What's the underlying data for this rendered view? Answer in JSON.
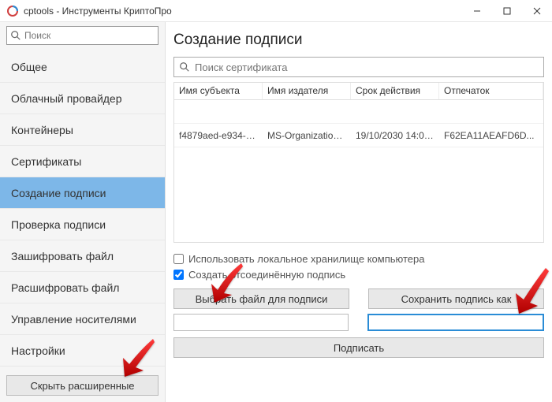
{
  "titlebar": {
    "title": "cptools - Инструменты КриптоПро"
  },
  "sidebar": {
    "search_placeholder": "Поиск",
    "items": [
      {
        "label": "Общее"
      },
      {
        "label": "Облачный провайдер"
      },
      {
        "label": "Контейнеры"
      },
      {
        "label": "Сертификаты"
      },
      {
        "label": "Создание подписи"
      },
      {
        "label": "Проверка подписи"
      },
      {
        "label": "Зашифровать файл"
      },
      {
        "label": "Расшифровать файл"
      },
      {
        "label": "Управление носителями"
      },
      {
        "label": "Настройки"
      }
    ],
    "bottom_button": "Скрыть расширенные"
  },
  "main": {
    "heading": "Создание подписи",
    "cert_search_placeholder": "Поиск сертификата",
    "columns": {
      "subject": "Имя субъекта",
      "issuer": "Имя издателя",
      "expiry": "Срок действия",
      "thumbprint": "Отпечаток"
    },
    "rows": [
      {
        "subject": "f4879aed-e934-40...",
        "issuer": "MS-Organization-...",
        "expiry": "19/10/2030 14:00:...",
        "thumbprint": "F62EA11AEAFD6D..."
      }
    ],
    "opt_local_store": "Использовать локальное хранилище компьютера",
    "opt_detached": "Создать отсоединённую подпись",
    "btn_choose_file": "Выбрать файл для подписи",
    "btn_save_as": "Сохранить подпись как",
    "btn_sign": "Подписать"
  }
}
